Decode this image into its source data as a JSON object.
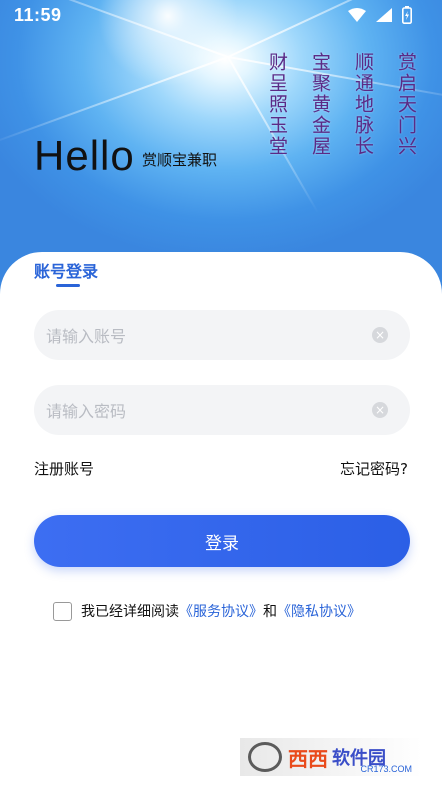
{
  "status": {
    "time": "11:59",
    "icons": [
      "wifi-icon",
      "signal-icon",
      "battery-icon"
    ]
  },
  "hero": {
    "title": "Hello",
    "subtitle": "赏顺宝兼职",
    "poem_columns": [
      "赏启天门兴",
      "顺通地脉长",
      "宝聚黄金屋",
      "财呈照玉堂"
    ]
  },
  "login": {
    "tab_label": "账号登录",
    "account_placeholder": "请输入账号",
    "password_placeholder": "请输入密码",
    "register_label": "注册账号",
    "forgot_label": "忘记密码?",
    "submit_label": "登录",
    "agree_prefix": "我已经详细阅读",
    "service_agreement": "《服务协议》",
    "and_text": "和",
    "privacy_agreement": "《隐私协议》"
  },
  "watermark": {
    "brand": "西西",
    "brand2": "软件园",
    "site": "CR173.COM"
  },
  "colors": {
    "accent": "#2a64d8",
    "button": "#3366ee",
    "field_bg": "#f3f4f6"
  }
}
